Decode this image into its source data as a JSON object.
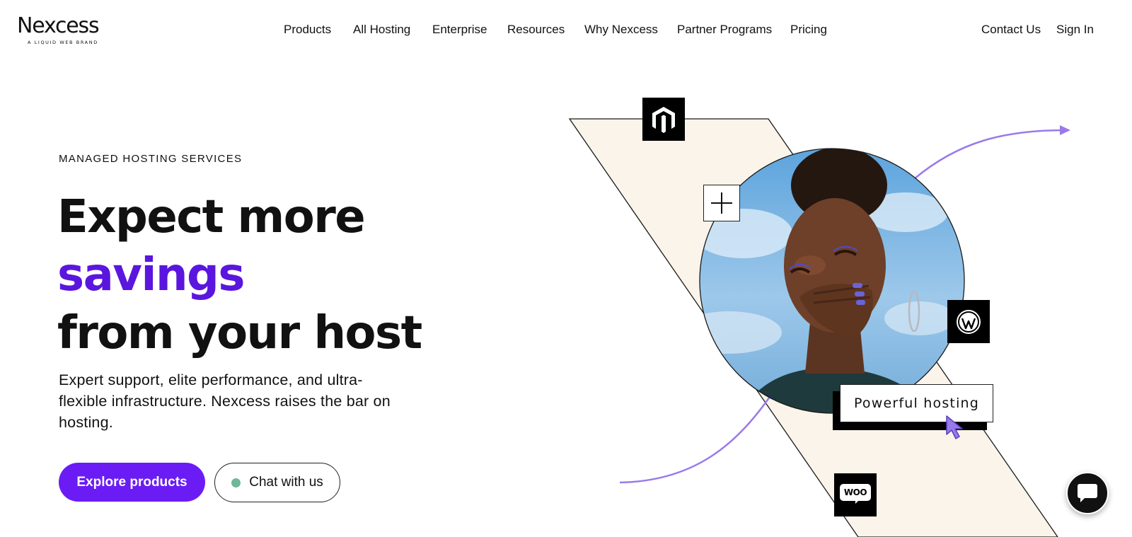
{
  "logo": {
    "name": "Nexcess",
    "tagline": "A LIQUID WEB BRAND"
  },
  "nav": {
    "items": [
      "Products",
      "All Hosting",
      "Enterprise",
      "Resources",
      "Why Nexcess",
      "Partner Programs",
      "Pricing"
    ],
    "contact": "Contact Us",
    "sign_in": "Sign In"
  },
  "hero": {
    "eyebrow": "MANAGED HOSTING SERVICES",
    "headline_line1": "Expect more",
    "headline_accent": "savings",
    "headline_line3": "from your host",
    "description": "Expert support, elite performance, and ultra-flexible infrastructure. Nexcess raises the bar on hosting.",
    "primary_cta": "Explore products",
    "secondary_cta": "Chat with us"
  },
  "illustration": {
    "card_label": "Powerful hosting",
    "badge_woo": "WOO",
    "icons": [
      "magento-icon",
      "plus-icon",
      "wordpress-icon",
      "woocommerce-icon",
      "cursor-icon",
      "arrow-icon"
    ]
  },
  "colors": {
    "accent": "#6b1cf5",
    "accent_text": "#5a16de",
    "arrow": "#9a7aea",
    "band": "#faf4ea",
    "status_dot": "#6fb79a"
  }
}
